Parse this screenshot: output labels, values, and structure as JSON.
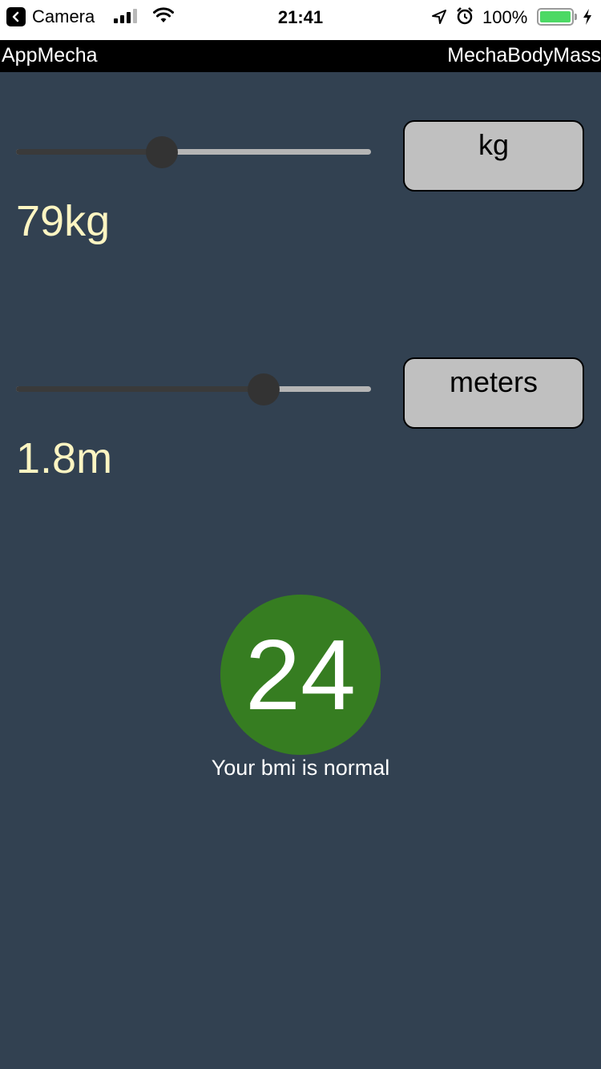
{
  "status_bar": {
    "back_app_label": "Camera",
    "time": "21:41",
    "battery_percent": "100%",
    "battery_level": 1.0,
    "signal_bars_active": 3,
    "signal_bars_total": 4,
    "icons": [
      "back-icon",
      "signal-icon",
      "wifi-icon",
      "location-icon",
      "alarm-icon",
      "battery-icon",
      "charging-icon"
    ]
  },
  "app_bar": {
    "left_title": "AppMecha",
    "right_title": "MechaBodyMass"
  },
  "weight": {
    "slider_fraction": 0.41,
    "unit_button_label": "kg",
    "value_label": "79kg"
  },
  "height": {
    "slider_fraction": 0.697,
    "unit_button_label": "meters",
    "value_label": "1.8m"
  },
  "bmi": {
    "value": "24",
    "message": "Your bmi is normal"
  },
  "colors": {
    "background": "#324151",
    "value_text": "#fdf5c2",
    "bmi_circle": "#367d21",
    "button_bg": "#c0c0c0",
    "slider_thumb": "#333333",
    "slider_track": "#b5b5b5"
  }
}
